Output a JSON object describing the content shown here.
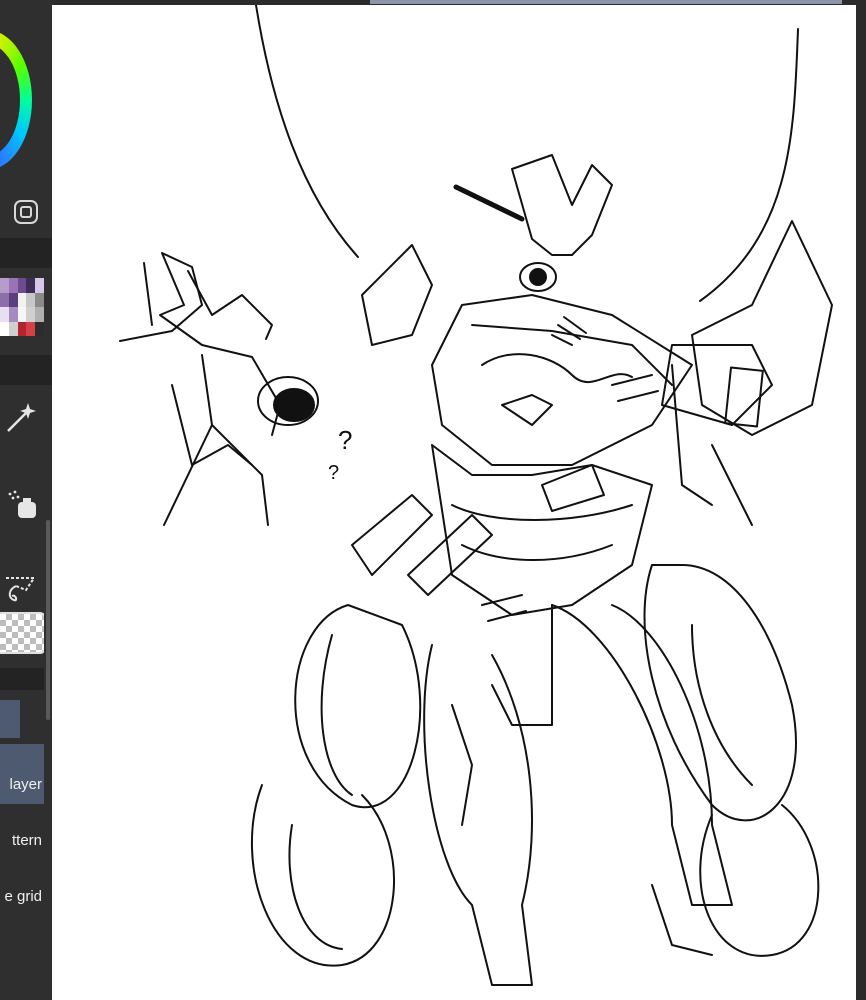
{
  "side_panel": {
    "layer_menu": {
      "add_layer_label": "layer",
      "pattern_label": "ttern",
      "grid_label": "e grid"
    },
    "accent_color": "#4d5a70",
    "icons": [
      "color-wheel-icon",
      "wheel-mode-toggle-icon",
      "magic-wand-icon",
      "spray-icon",
      "lasso-icon",
      "transparency-icon"
    ]
  },
  "palette": {
    "swatches": [
      "#b79bc8",
      "#9a73b6",
      "#6c4c8f",
      "#3e2d56",
      "#d7c7e6",
      "#8c6ea8",
      "#5c3d7d",
      "#f2f2f2",
      "#c7c7c7",
      "#8a8a8a",
      "#e8dff0",
      "#a68bbf",
      "#f6f6f6",
      "#d0d0d0",
      "#b0b0b0",
      "#ffffff",
      "#cfcfcf",
      "#b3262e",
      "#d84048",
      "#2c2c2c"
    ]
  },
  "canvas": {
    "background": "#ffffff",
    "content": "robot-sketch"
  }
}
